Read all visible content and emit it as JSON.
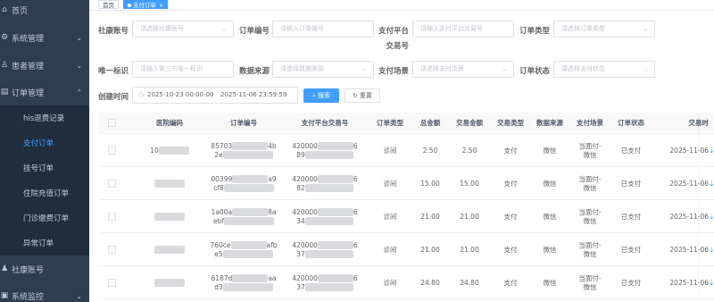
{
  "sidebar": {
    "items": [
      {
        "label": "首页",
        "icon": "home-icon"
      },
      {
        "label": "系统管理",
        "icon": "settings-icon"
      },
      {
        "label": "患者管理",
        "icon": "user-icon"
      },
      {
        "label": "订单管理",
        "icon": "order-icon"
      }
    ],
    "sub_items": [
      {
        "label": "his退费记录"
      },
      {
        "label": "支付订单"
      },
      {
        "label": "挂号订单"
      },
      {
        "label": "住院充值订单"
      },
      {
        "label": "门诊缴费订单"
      },
      {
        "label": "异常订单"
      }
    ],
    "bottom_items": [
      {
        "label": "社康账号",
        "icon": "account-icon"
      },
      {
        "label": "系统监控",
        "icon": "monitor-icon"
      }
    ]
  },
  "tabs": [
    {
      "label": "首页"
    },
    {
      "label": "支付订单",
      "close": "×"
    }
  ],
  "filters": {
    "shekang_label": "社康账号",
    "shekang_placeholder": "请选择社康账号",
    "order_no_label": "订单编号",
    "order_no_placeholder": "请输入订单编号",
    "pay_platform_label_1": "支付平台",
    "pay_platform_label_2": "交易号",
    "pay_platform_placeholder": "请输入支付平台交易号",
    "order_type_label": "订单类型",
    "order_type_placeholder": "请选择订单类型",
    "unique_id_label": "唯一标识",
    "unique_id_placeholder": "请输入第三方唯一标识",
    "data_source_label": "数据来源",
    "data_source_placeholder": "请选择数据来源",
    "pay_scene_label": "支付场景",
    "pay_scene_placeholder": "请选择支付场景",
    "order_status_label": "订单状态",
    "order_status_placeholder": "请选择支付状态",
    "created_label": "创建时间",
    "date_start": "2025-10-23 00:00:00",
    "date_sep": "-",
    "date_end": "2025-11-06 23:59:59",
    "search_btn": "搜索",
    "reset_btn": "重置"
  },
  "table": {
    "headers": [
      "医院编码",
      "订单编号",
      "支付平台交易号",
      "订单类型",
      "总金额",
      "交易金额",
      "交易类型",
      "数据来源",
      "支付场景",
      "订单状态",
      "交易时"
    ],
    "rows": [
      {
        "hosp": "10",
        "order_a": "85703",
        "order_a_end": "4b",
        "order_b": "2e",
        "trade_a": "420000",
        "trade_a_end": "6",
        "trade_b": "89",
        "type": "诊间",
        "total": "2.50",
        "amount": "2.50",
        "trade_type": "支付",
        "source": "微信",
        "scene_1": "当面付-",
        "scene_2": "微信",
        "status": "已支付",
        "time": "2025-11-06"
      },
      {
        "hosp": "",
        "order_a": "00399",
        "order_a_end": "a9",
        "order_b": "cf8",
        "trade_a": "420000",
        "trade_a_end": "6",
        "trade_b": "82",
        "type": "诊间",
        "total": "15.00",
        "amount": "15.00",
        "trade_type": "支付",
        "source": "微信",
        "scene_1": "当面付-",
        "scene_2": "微信",
        "status": "已支付",
        "time": "2025-11-06"
      },
      {
        "hosp": "",
        "order_a": "1a00a",
        "order_a_end": "8a",
        "order_b": "ebf",
        "trade_a": "420000",
        "trade_a_end": "6",
        "trade_b": "34",
        "type": "诊间",
        "total": "21.00",
        "amount": "21.00",
        "trade_type": "支付",
        "source": "微信",
        "scene_1": "当面付-",
        "scene_2": "微信",
        "status": "已支付",
        "time": "2025-11-06"
      },
      {
        "hosp": "",
        "order_a": "760ce",
        "order_a_end": "afb",
        "order_b": "e5",
        "trade_a": "420000",
        "trade_a_end": "6",
        "trade_b": "37",
        "type": "诊间",
        "total": "21.00",
        "amount": "21.00",
        "trade_type": "支付",
        "source": "微信",
        "scene_1": "当面付-",
        "scene_2": "微信",
        "status": "已支付",
        "time": "2025-11-06"
      },
      {
        "hosp": "",
        "order_a": "6187d",
        "order_a_end": "aa",
        "order_b": "d3",
        "trade_a": "420000",
        "trade_a_end": "6",
        "trade_b": "37",
        "type": "诊间",
        "total": "24.80",
        "amount": "24.80",
        "trade_type": "支付",
        "source": "微信",
        "scene_1": "当面付-",
        "scene_2": "微信",
        "status": "已支付",
        "time": "2025-11-06"
      }
    ]
  },
  "colors": {
    "sidebar_bg": "#2f3d50",
    "submenu_bg": "#1f2d3d",
    "accent": "#409eff"
  }
}
